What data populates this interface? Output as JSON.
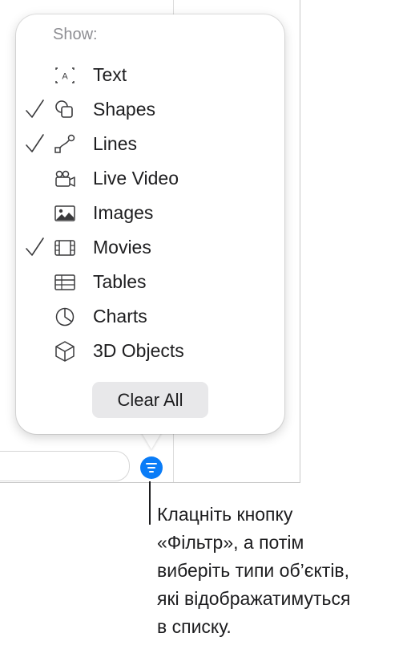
{
  "popover": {
    "header": "Show:",
    "items": [
      {
        "label": "Text",
        "icon": "text-box-icon",
        "checked": false
      },
      {
        "label": "Shapes",
        "icon": "shapes-icon",
        "checked": true
      },
      {
        "label": "Lines",
        "icon": "lines-icon",
        "checked": true
      },
      {
        "label": "Live Video",
        "icon": "live-video-icon",
        "checked": false
      },
      {
        "label": "Images",
        "icon": "image-icon",
        "checked": false
      },
      {
        "label": "Movies",
        "icon": "film-icon",
        "checked": true
      },
      {
        "label": "Tables",
        "icon": "table-icon",
        "checked": false
      },
      {
        "label": "Charts",
        "icon": "pie-chart-icon",
        "checked": false
      },
      {
        "label": "3D Objects",
        "icon": "cube-icon",
        "checked": false
      }
    ],
    "clear_all_label": "Clear All"
  },
  "filter_button": {
    "icon": "filter-icon",
    "color": "#0a7cf7"
  },
  "callout": {
    "lines": [
      "Клацніть кнопку",
      "«Фільтр», а потім",
      "виберіть типи об’єктів,",
      "які відображатимуться",
      "в списку."
    ]
  }
}
